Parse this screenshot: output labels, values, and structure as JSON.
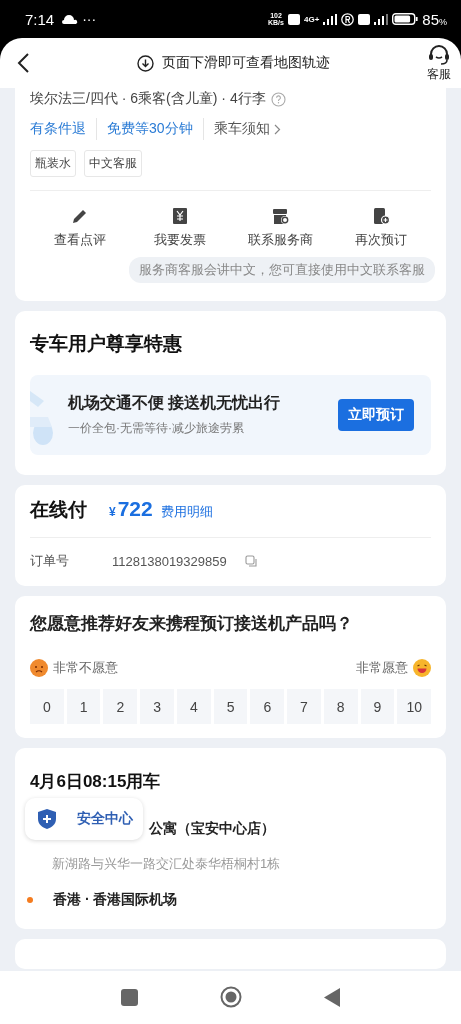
{
  "status_bar": {
    "time": "7:14",
    "more": "···",
    "speed_value": "102",
    "speed_unit": "KB/s",
    "network": "4G+",
    "battery": "85",
    "battery_unit": "%"
  },
  "header": {
    "hint": "页面下滑即可查看地图轨迹",
    "service_label": "客服"
  },
  "vehicle_card": {
    "summary": "埃尔法三/四代 · 6乘客(含儿童) · 4行李",
    "policies": [
      {
        "label": "有条件退",
        "kind": "highlight"
      },
      {
        "label": "免费等30分钟",
        "kind": "highlight"
      },
      {
        "label": "乘车须知",
        "kind": "link"
      }
    ],
    "tags": [
      "瓶装水",
      "中文客服"
    ],
    "actions": [
      {
        "label": "查看点评",
        "kind": "review"
      },
      {
        "label": "我要发票",
        "kind": "invoice"
      },
      {
        "label": "联系服务商",
        "kind": "contact"
      },
      {
        "label": "再次预订",
        "kind": "rebook"
      }
    ],
    "tooltip": "服务商客服会讲中文，您可直接使用中文联系客服"
  },
  "promo_card": {
    "title": "专车用户尊享特惠",
    "banner_title": "机场交通不便 接送机无忧出行",
    "banner_subtitle": "一价全包·无需等待·减少旅途劳累",
    "button": "立即预订"
  },
  "payment_card": {
    "label": "在线付",
    "currency": "¥",
    "amount": "722",
    "details_link": "费用明细",
    "order_label": "订单号",
    "order_number": "1128138019329859"
  },
  "survey_card": {
    "question": "您愿意推荐好友来携程预订接送机产品吗？",
    "low_label": "非常不愿意",
    "high_label": "非常愿意",
    "scores": [
      {
        "label": "0",
        "selected": false
      },
      {
        "label": "1",
        "selected": false
      },
      {
        "label": "2",
        "selected": false
      },
      {
        "label": "3",
        "selected": false
      },
      {
        "label": "4",
        "selected": false
      },
      {
        "label": "5",
        "selected": false
      },
      {
        "label": "6",
        "selected": false
      },
      {
        "label": "7",
        "selected": false
      },
      {
        "label": "8",
        "selected": false
      },
      {
        "label": "9",
        "selected": false
      },
      {
        "label": "10",
        "selected": false
      }
    ]
  },
  "trip_card": {
    "title": "4月6日08:15用车",
    "pickup_name": "公寓（宝安中心店）",
    "pickup_address": "新湖路与兴华一路交汇处泰华梧桐村1栋",
    "dropoff": "香港 · 香港国际机场"
  },
  "safety_button": {
    "label": "安全中心"
  }
}
